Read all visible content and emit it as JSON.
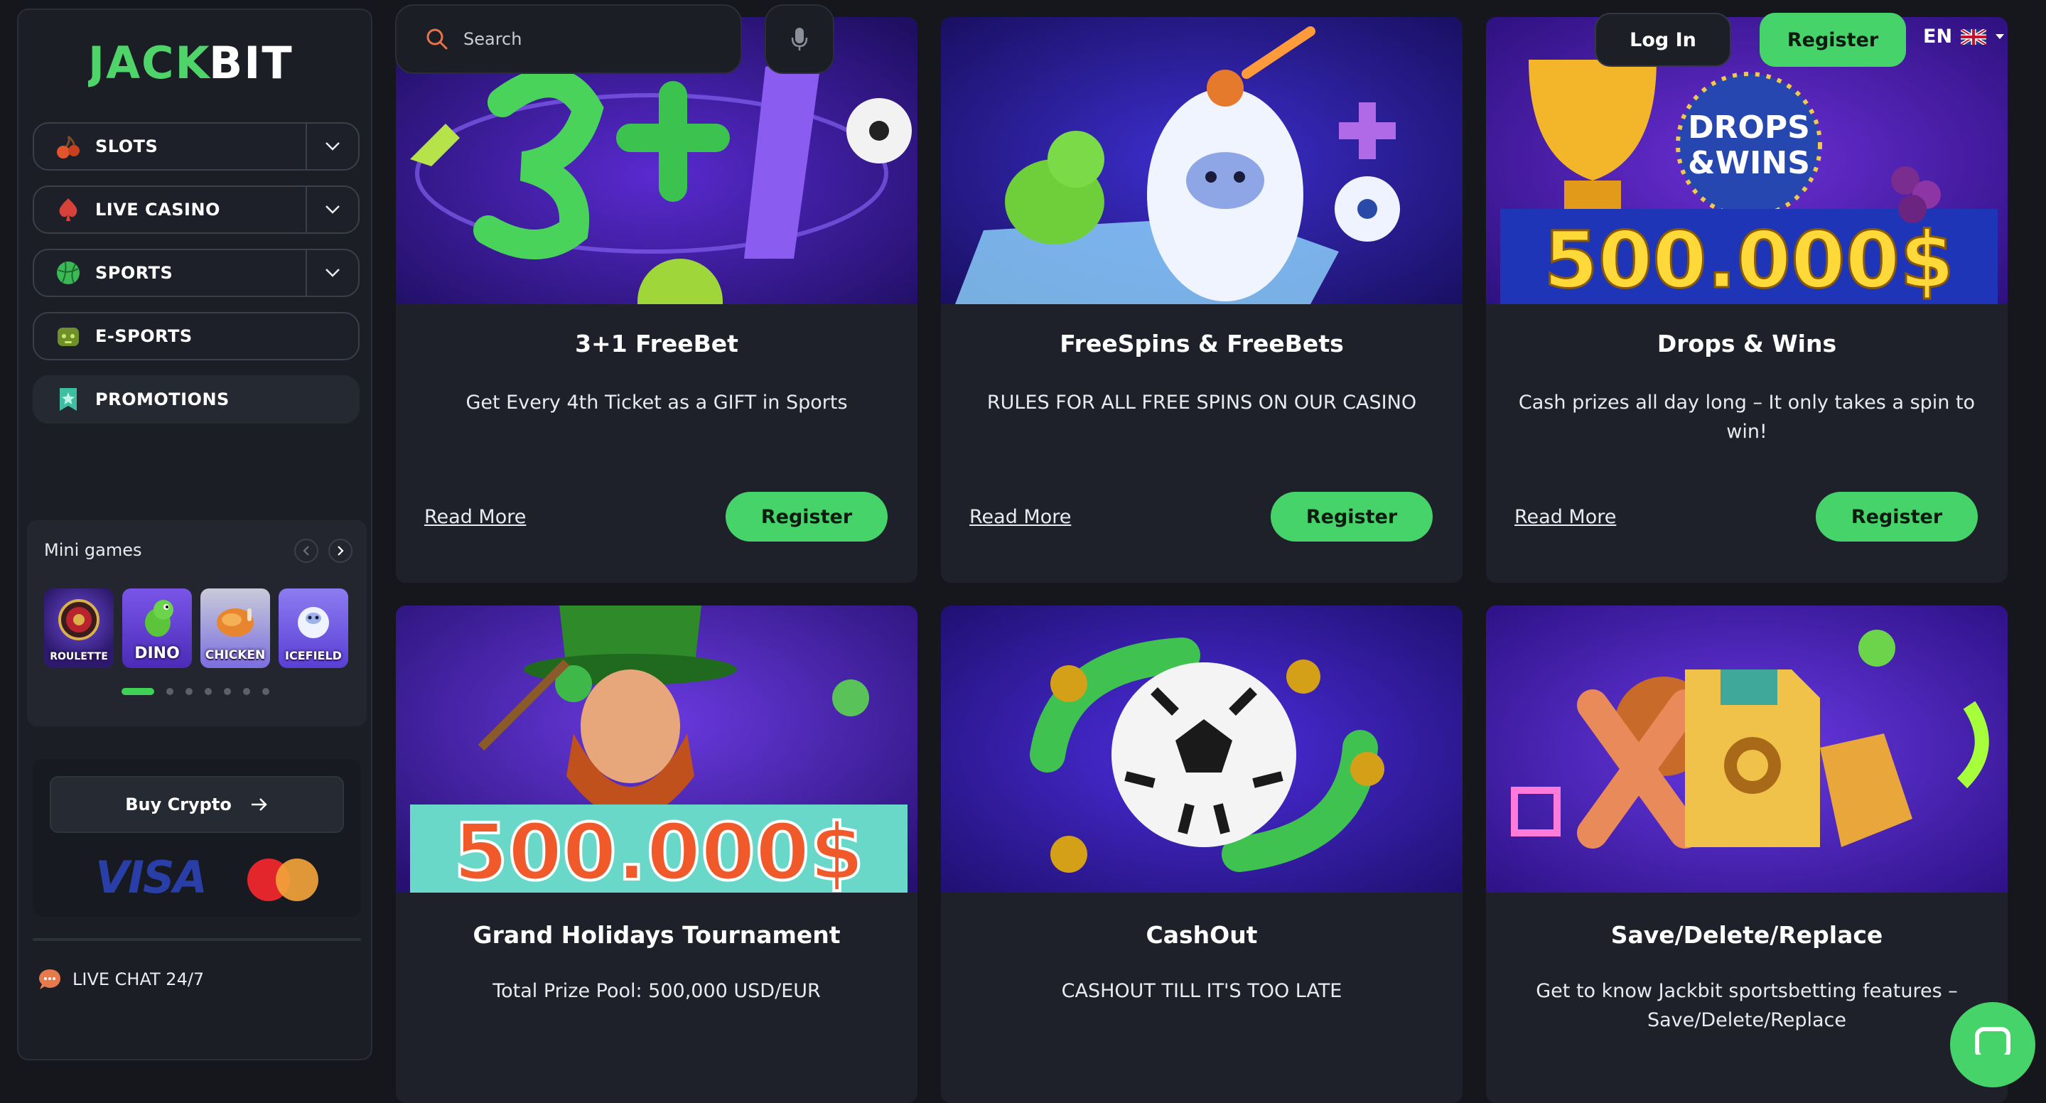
{
  "brand": {
    "logo_text_left": "JACK",
    "logo_text_right": "BIT"
  },
  "search": {
    "placeholder": "Search"
  },
  "header": {
    "login_label": "Log In",
    "register_label": "Register",
    "language": "EN"
  },
  "sidebar": {
    "items": [
      {
        "label": "SLOTS",
        "icon": "cherry-icon",
        "expandable": true
      },
      {
        "label": "LIVE CASINO",
        "icon": "spade-icon",
        "expandable": true
      },
      {
        "label": "SPORTS",
        "icon": "ball-icon",
        "expandable": true
      },
      {
        "label": "E-SPORTS",
        "icon": "gamepad-icon",
        "expandable": false
      },
      {
        "label": "PROMOTIONS",
        "icon": "badge-star-icon",
        "expandable": false,
        "active": true
      }
    ],
    "mini_games": {
      "title": "Mini games",
      "games": [
        "ROULETTE",
        "DINO",
        "CHICKEN",
        "ICEFIELD"
      ],
      "page_count": 7,
      "active_page": 1
    },
    "buy_crypto_label": "Buy Crypto",
    "payment_logos": [
      "VISA",
      "Mastercard"
    ],
    "live_chat_label": "LIVE CHAT 24/7"
  },
  "promotions": [
    {
      "title": "3+1 FreeBet",
      "description": "Get Every 4th Ticket as a GIFT in Sports",
      "read_more": "Read More",
      "register": "Register"
    },
    {
      "title": "FreeSpins & FreeBets",
      "description": "RULES FOR ALL FREE SPINS ON OUR CASINO",
      "read_more": "Read More",
      "register": "Register"
    },
    {
      "title": "Drops & Wins",
      "description": "Cash prizes all day long – It only takes a spin to win!",
      "read_more": "Read More",
      "register": "Register",
      "banner_line1": "DROPS",
      "banner_line2": "&WINS",
      "banner_amount": "500.000$"
    },
    {
      "title": "Grand Holidays Tournament",
      "description": "Total Prize Pool: 500,000 USD/EUR",
      "banner_amount": "500.000$"
    },
    {
      "title": "CashOut",
      "description": "CASHOUT TILL IT'S TOO LATE"
    },
    {
      "title": "Save/Delete/Replace",
      "description": "Get to know Jackbit sportsbetting features – Save/Delete/Replace"
    }
  ],
  "colors": {
    "accent": "#46d36a",
    "bg": "#15171d",
    "card": "#1e2129",
    "banner_purple": "#3b1aa6"
  }
}
